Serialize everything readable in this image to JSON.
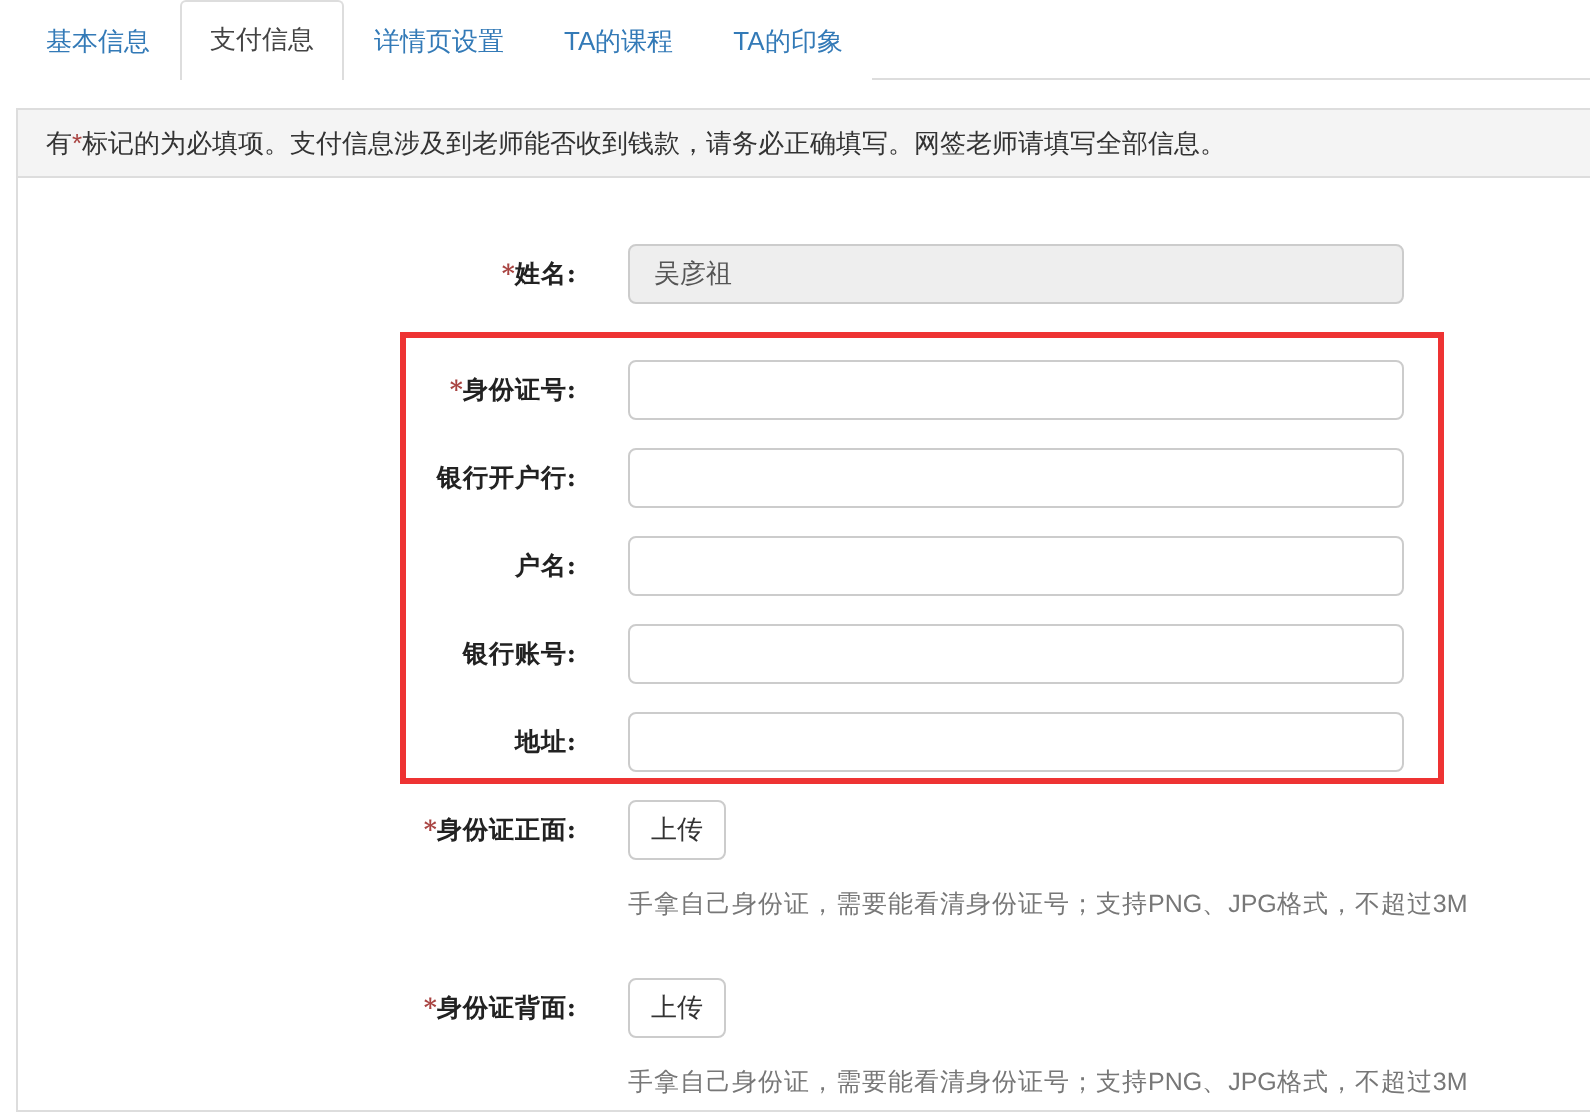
{
  "tabs": [
    {
      "label": "基本信息",
      "selected": false
    },
    {
      "label": "支付信息",
      "selected": true
    },
    {
      "label": "详情页设置",
      "selected": false
    },
    {
      "label": "TA的课程",
      "selected": false
    },
    {
      "label": "TA的印象",
      "selected": false
    }
  ],
  "notice": {
    "before": "有",
    "mark": "*",
    "after": "标记的为必填项。支付信息涉及到老师能否收到钱款，请务必正确填写。网签老师请填写全部信息。"
  },
  "fields": [
    {
      "kind": "text",
      "label": "姓名:",
      "required": true,
      "value": "吴彦祖",
      "disabled": true,
      "highlighted": false
    },
    {
      "kind": "text",
      "label": "身份证号:",
      "required": true,
      "disabled": false,
      "highlighted": true
    },
    {
      "kind": "text",
      "label": "银行开户行:",
      "required": false,
      "disabled": false,
      "highlighted": true
    },
    {
      "kind": "text",
      "label": "户名:",
      "required": false,
      "disabled": false,
      "highlighted": true
    },
    {
      "kind": "text",
      "label": "银行账号:",
      "required": false,
      "disabled": false,
      "highlighted": true
    },
    {
      "kind": "text",
      "label": "地址:",
      "required": false,
      "disabled": false,
      "highlighted": true
    },
    {
      "kind": "upload",
      "label": "身份证正面:",
      "required": true,
      "button": "上传",
      "hint": "手拿自己身份证，需要能看清身份证号；支持PNG、JPG格式，不超过3M",
      "highlighted": false
    },
    {
      "kind": "upload",
      "label": "身份证背面:",
      "required": true,
      "button": "上传",
      "hint": "手拿自己身份证，需要能看清身份证号；支持PNG、JPG格式，不超过3M",
      "highlighted": false
    }
  ]
}
